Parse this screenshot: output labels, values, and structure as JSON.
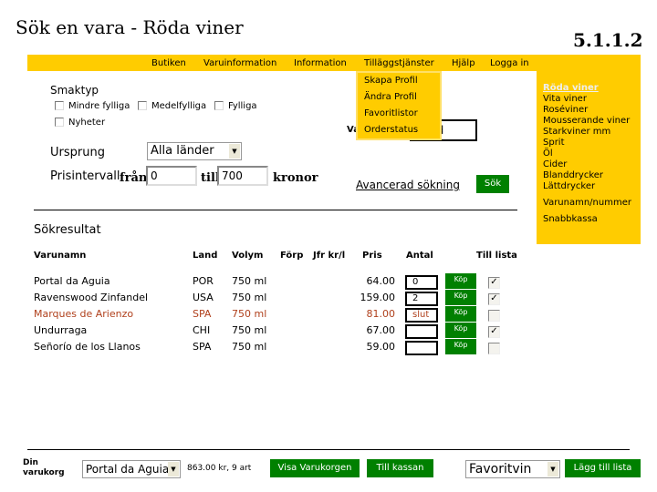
{
  "title": "Sök en vara - Röda viner",
  "version": "5.1.1.2",
  "nav": {
    "items": [
      "Butiken",
      "Varuinformation",
      "Information",
      "Tilläggstjänster",
      "Hjälp",
      "Logga in"
    ]
  },
  "dropdown": {
    "items": [
      "Skapa Profil",
      "Ändra Profil",
      "Favoritlistor",
      "Orderstatus"
    ]
  },
  "sidebar": {
    "active": "Röda viner",
    "items": [
      "Vita viner",
      "Roséviner",
      "Mousserande viner",
      "Starkviner mm",
      "Sprit",
      "Öl",
      "Cider",
      "Blanddrycker",
      "Lättdrycker"
    ],
    "extra": [
      "Varunamn/nummer",
      "Snabbkassa"
    ]
  },
  "search": {
    "smaktyp_label": "Smaktyp",
    "options": [
      "Mindre fylliga",
      "Medelfylliga",
      "Fylliga",
      "Nyheter"
    ],
    "ursprung_label": "Ursprung",
    "ursprung_value": "Alla länder",
    "pris_label": "Prisintervall",
    "from_label": "från",
    "from_value": "0",
    "to_label": "till",
    "to_value": "700",
    "unit": "kronor",
    "name_label": "Va",
    "name_value": "nd",
    "advanced": "Avancerad sökning",
    "search_button": "Sök"
  },
  "results": {
    "heading": "Sökresultat",
    "columns": [
      "Varunamn",
      "Land",
      "Volym",
      "Förp",
      "Jfr kr/l",
      "Pris",
      "Antal",
      "Till lista"
    ],
    "rows": [
      {
        "name": "Portal da Aguia",
        "land": "POR",
        "volym": "750 ml",
        "pris": "64.00",
        "antal": "0",
        "buy": "Köp",
        "listed": true,
        "out": false
      },
      {
        "name": "Ravenswood Zinfandel",
        "land": "USA",
        "volym": "750 ml",
        "pris": "159.00",
        "antal": "2",
        "buy": "Köp",
        "listed": true,
        "out": false
      },
      {
        "name": "Marques de Arienzo",
        "land": "SPA",
        "volym": "750 ml",
        "pris": "81.00",
        "antal": "slut",
        "buy": "Köp",
        "listed": false,
        "out": true
      },
      {
        "name": "Undurraga",
        "land": "CHI",
        "volym": "750 ml",
        "pris": "67.00",
        "antal": "",
        "buy": "Köp",
        "listed": true,
        "out": false
      },
      {
        "name": "Señorío de los Llanos",
        "land": "SPA",
        "volym": "750 ml",
        "pris": "59.00",
        "antal": "",
        "buy": "Köp",
        "listed": false,
        "out": false
      }
    ]
  },
  "footer": {
    "cart_label_1": "Din",
    "cart_label_2": "varukorg",
    "cart_select": "Portal da Aguia",
    "summary": "863.00 kr, 9 art",
    "show_cart": "Visa Varukorgen",
    "checkout": "Till kassan",
    "list_select": "Favoritvin",
    "add_to_list": "Lägg till lista"
  },
  "colors": {
    "accent": "#ffcc00",
    "button": "#008000",
    "out_of_stock": "#b0401c"
  }
}
